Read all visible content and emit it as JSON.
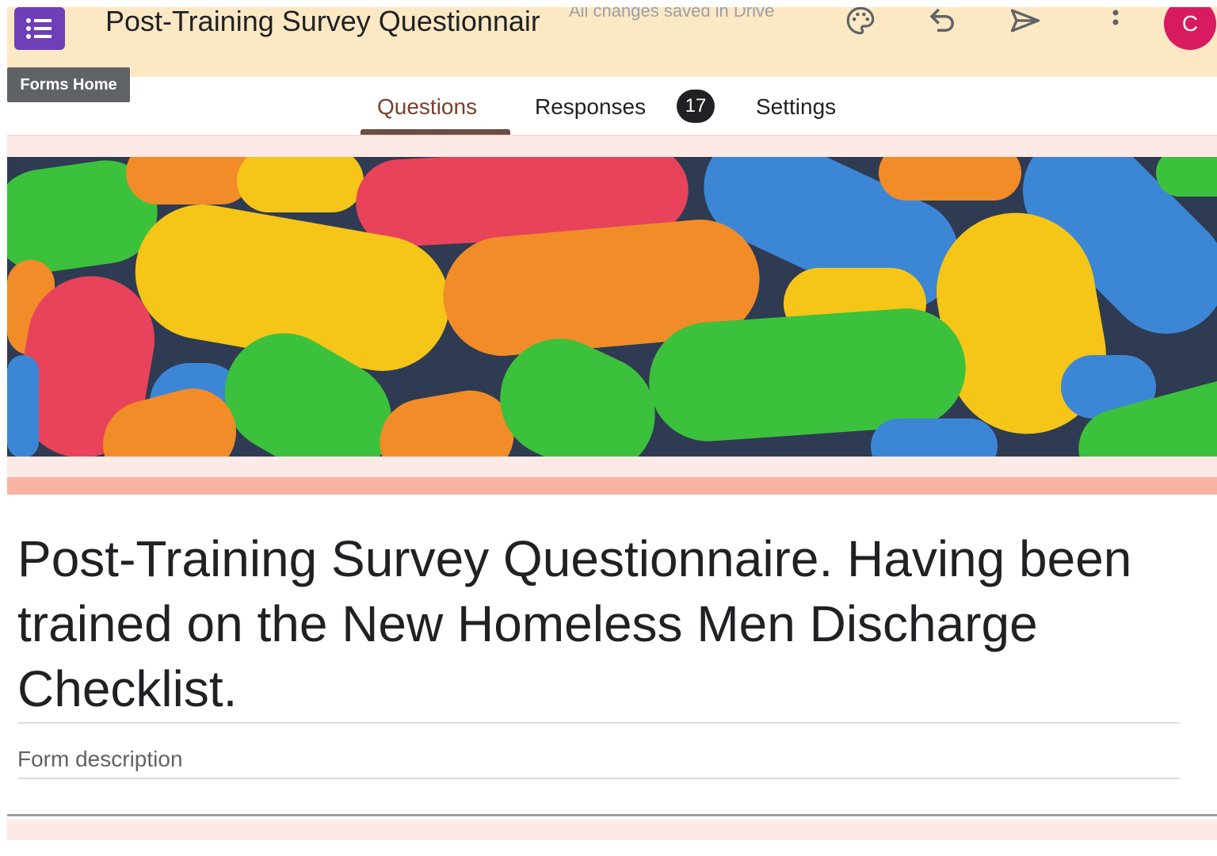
{
  "header": {
    "app_icon": "forms-list-icon",
    "title": "Post-Training Survey Questionnaire",
    "save_status": "All changes saved in Drive",
    "icons": [
      "palette-icon",
      "undo-icon",
      "send-icon",
      "more-vert-icon"
    ],
    "avatar_initial": "C",
    "tooltip": "Forms Home"
  },
  "tabs": {
    "items": [
      {
        "label": "Questions",
        "active": true
      },
      {
        "label": "Responses",
        "badge": "17"
      },
      {
        "label": "Settings"
      }
    ]
  },
  "form": {
    "title": "Post-Training Survey Questionnaire. Having been trained on the New Homeless Men Discharge Checklist.",
    "description_placeholder": "Form description"
  },
  "colors": {
    "header_bg": "#fde8c4",
    "theme_accent": "#f8b4a3",
    "theme_band": "#fde9e6",
    "app_icon_bg": "#6e3fb8",
    "avatar_bg": "#d81b60",
    "active_tab": "#7b3f2a"
  }
}
